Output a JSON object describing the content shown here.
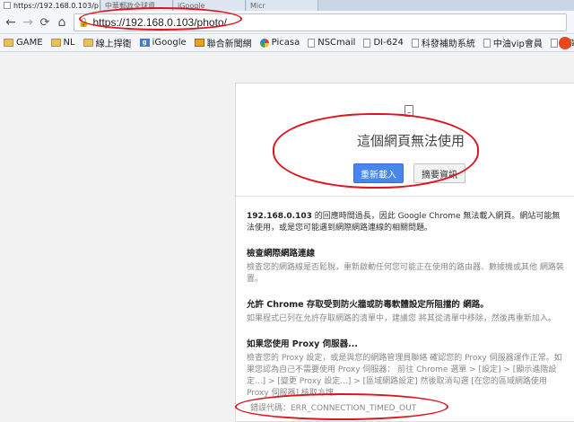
{
  "tabs": [
    {
      "title": "https://192.168.0.103/p",
      "close": "×"
    },
    {
      "title": "中華郵政全球資"
    },
    {
      "title": "iGoogle"
    },
    {
      "title": "Micr"
    }
  ],
  "toolbar": {
    "back": "←",
    "forward": "→",
    "reload": "⟳",
    "home": "⌂",
    "url": "https://192.168.0.103/photo/"
  },
  "bookmarks": [
    {
      "label": "GAME",
      "icon": "folder-icon"
    },
    {
      "label": "NL",
      "icon": "folder-icon"
    },
    {
      "label": "線上捍衛",
      "icon": "folder-icon"
    },
    {
      "label": "iGoogle",
      "icon": "google-icon"
    },
    {
      "label": "聯合新聞網",
      "icon": "news-icon"
    },
    {
      "label": "Picasa",
      "icon": "picasa-icon"
    },
    {
      "label": "NSCmail",
      "icon": "page-icon"
    },
    {
      "label": "DI-624",
      "icon": "page-icon"
    },
    {
      "label": "科發補助系統",
      "icon": "page-icon"
    },
    {
      "label": "中油vip會員",
      "icon": "page-icon"
    },
    {
      "label": "台灣彩券",
      "icon": "page-icon"
    }
  ],
  "error": {
    "headline": "這個網頁無法使用",
    "reload_label": "重新載入",
    "details_label": "摘要資訊",
    "summary_host": "192.168.0.103",
    "summary_text": " 的回應時間過長，因此 Google Chrome 無法載入網頁。網站可能無法使用，或是您可能遇到網際網路連線的相關問題。",
    "s1_title": "檢查網際網路連線",
    "s1_text": "檢查您的網路線是否鬆脫，重新啟動任何您可能正在使用的路由器、數據機或其他 網路裝置。",
    "s2_title": "允許 Chrome 存取受到防火牆或防毒軟體設定所阻擋的 網路。",
    "s2_text": "如果程式已列在允許存取網路的清單中，建議您 將其從清單中移除，然後再重新加入。",
    "s3_title": "如果您使用 Proxy 伺服器...",
    "s3_text": "檢查您的 Proxy 設定，或是與您的網路管理員聯絡 確認您的 Proxy 伺服器運作正常。如果您認為自己不需要使用 Proxy 伺服器： 前往 Chrome 選單 > [設定] > [顯示進階設定...] > [變更 Proxy 設定...] > [區域網路設定] 然後取消勾選 [在您的區域網路使用 Proxy 伺服器] 核取方塊。",
    "error_code": "錯誤代碼：ERR_CONNECTION_TIMED_OUT"
  },
  "colors": {
    "accent_button": "#4787ed",
    "annotation_marker": "#e0141f"
  }
}
